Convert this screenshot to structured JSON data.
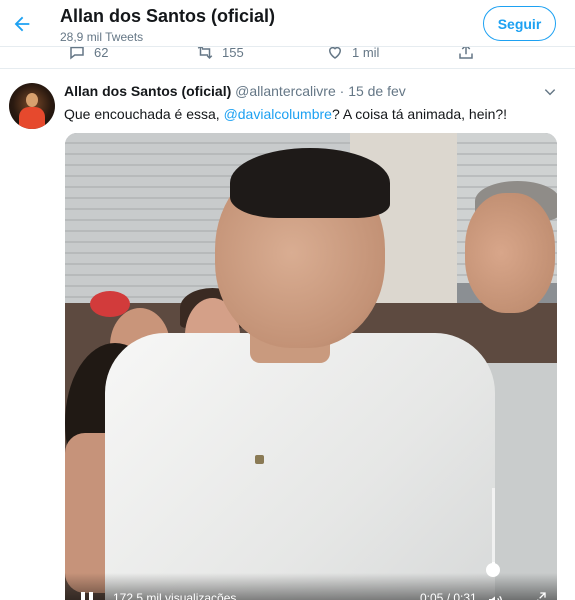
{
  "header": {
    "title": "Allan dos Santos (oficial)",
    "tweet_count": "28,9 mil Tweets",
    "follow_label": "Seguir",
    "back_icon": "arrow-left-icon"
  },
  "prev_tweet_actions": {
    "replies": "62",
    "retweets": "155",
    "likes": "1 mil"
  },
  "tweet": {
    "name": "Allan dos Santos (oficial)",
    "handle": "@allantercalivre",
    "separator": "·",
    "date": "15 de fev",
    "text_before": "Que encouchada é essa, ",
    "mention": "@davialcolumbre",
    "text_after": "? A coisa tá animada, hein?!"
  },
  "video": {
    "views": "172,5 mil visualizações",
    "time": "0:05 / 0:31",
    "volume_level": 0.05,
    "icons": [
      "pause-icon",
      "volume-icon",
      "fullscreen-icon"
    ]
  },
  "colors": {
    "accent": "#1da1f2",
    "text": "#14171a",
    "secondary": "#657786",
    "border": "#e6ecf0"
  }
}
